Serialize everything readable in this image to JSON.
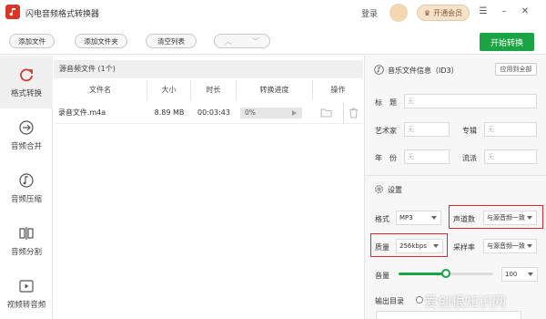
{
  "app": {
    "title": "闪电音频格式转换器"
  },
  "titlebar": {
    "login": "登录",
    "vip": "开通会员"
  },
  "toolbar": {
    "add_file": "添加文件",
    "add_folder": "添加文件夹",
    "clear_list": "清空列表",
    "start": "开始转换"
  },
  "sidebar": {
    "items": [
      {
        "label": "格式转换",
        "icon": "refresh-icon"
      },
      {
        "label": "音频合并",
        "icon": "merge-icon"
      },
      {
        "label": "音频压缩",
        "icon": "music-note-icon"
      },
      {
        "label": "音频分割",
        "icon": "split-icon"
      },
      {
        "label": "视频转音频",
        "icon": "video-play-icon"
      }
    ]
  },
  "file_list": {
    "title": "源音频文件 (1个)",
    "columns": [
      "文件名",
      "大小",
      "时长",
      "转换进度",
      "操作"
    ],
    "rows": [
      {
        "name": "录音文件.m4a",
        "size": "8.89 MB",
        "duration": "00:03:43",
        "progress_text": "0%",
        "progress": 0
      }
    ]
  },
  "id3": {
    "title": "音乐文件信息（ID3）",
    "apply_all": "应用到全部",
    "fields": {
      "title_label": "标　题",
      "artist_label": "艺术家",
      "album_label": "专辑",
      "year_label": "年　份",
      "genre_label": "流派",
      "placeholder": "无"
    }
  },
  "settings": {
    "title": "设置",
    "format_label": "格式",
    "format_value": "MP3",
    "channels_label": "声道数",
    "channels_value": "与源音频一致",
    "quality_label": "质量",
    "quality_value": "256kbps",
    "samplerate_label": "采样率",
    "samplerate_value": "与源音频一致",
    "volume_label": "音量",
    "volume_value": "100",
    "volume_fraction": 0.5,
    "output_label": "输出目录"
  },
  "watermark": "爱创根知识网",
  "colors": {
    "accent": "#1aa443",
    "highlight": "#e0262a",
    "brand": "#d9362b"
  }
}
